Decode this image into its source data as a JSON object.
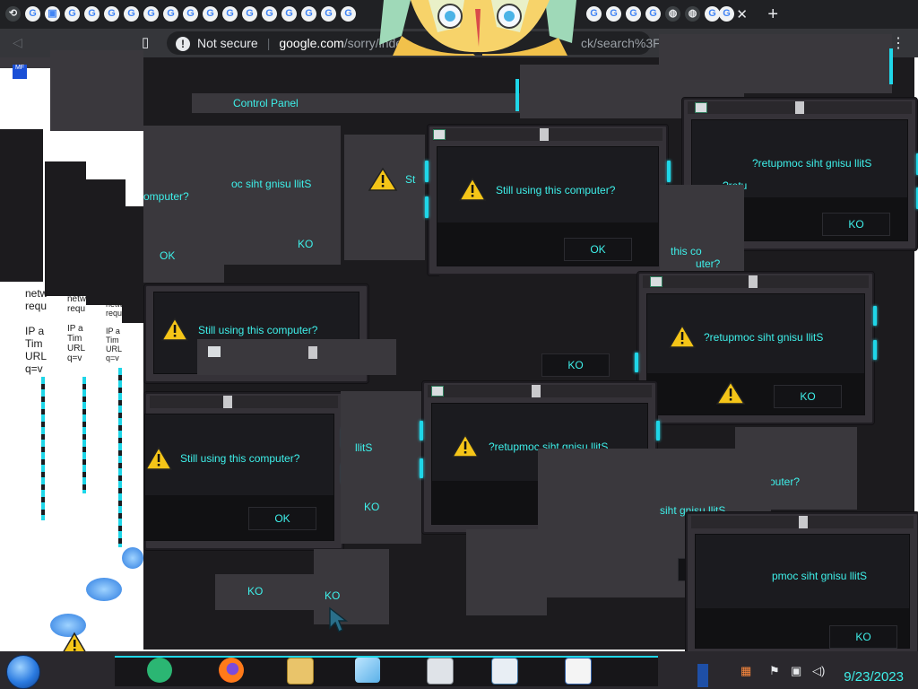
{
  "browser": {
    "address_security": "Not secure",
    "address_domain": "google.com",
    "address_rest": "/sorry/index?continue=http://g0000.ck/search%3Fq",
    "address_rest_visible": "/sorry/inde",
    "address_rest_visible_2": "ue=http://g",
    "address_rest_visible_3": "ck/search%3Fq",
    "new_tab_label": "+",
    "close_tab_label": "✕",
    "menu_label": "⋮"
  },
  "control_panel": {
    "title": "Control Panel"
  },
  "dialogs": [
    {
      "message": "Still using this computer?",
      "ok": "OK"
    },
    {
      "message": "?retupmoc siht gnisu llitS",
      "ok": "KO"
    },
    {
      "message": "Still using this computer?",
      "ok": "OK"
    },
    {
      "message": "?retupmoc siht gnisu llitS",
      "ok": "KO"
    },
    {
      "message": "Still using this computer?",
      "ok": "OK"
    },
    {
      "message": "?retupmoc siht gnisu llitS",
      "ok": "KO"
    },
    {
      "message": "?retupmoc siht gnisu llitS",
      "ok": "KO"
    },
    {
      "message": "Still using this computer?",
      "ok": "OK"
    }
  ],
  "fragments": {
    "f1": "omputer?",
    "f2": "oc siht gnisu llitS",
    "f3": "St",
    "f4": "this co",
    "f5": "uter?",
    "f6": "llitS",
    "f7": "siht gnisu llitS",
    "f8": "outer?",
    "f9": "upmoc siht gnisu llitS",
    "f10": "?retu",
    "f11": "pmoc siht gnisu llitS",
    "ok1": "OK",
    "ko1": "KO",
    "ko2": "KO",
    "ko3": "KO",
    "ko4": "KO",
    "ko5": "KO",
    "ko6": "KO",
    "ko7": "KO"
  },
  "page_text": {
    "l1": "netw",
    "l2": "requ",
    "l3": "IP a",
    "l4": "Tim",
    "l5": "URL",
    "l6": "q=v"
  },
  "taskbar": {
    "clock_date": "9/23/2023"
  },
  "colors": {
    "accent": "#3ef0ea",
    "led": "#1fd6e8",
    "dialog_body": "#353238",
    "dialog_inner": "#1b1b1f"
  }
}
